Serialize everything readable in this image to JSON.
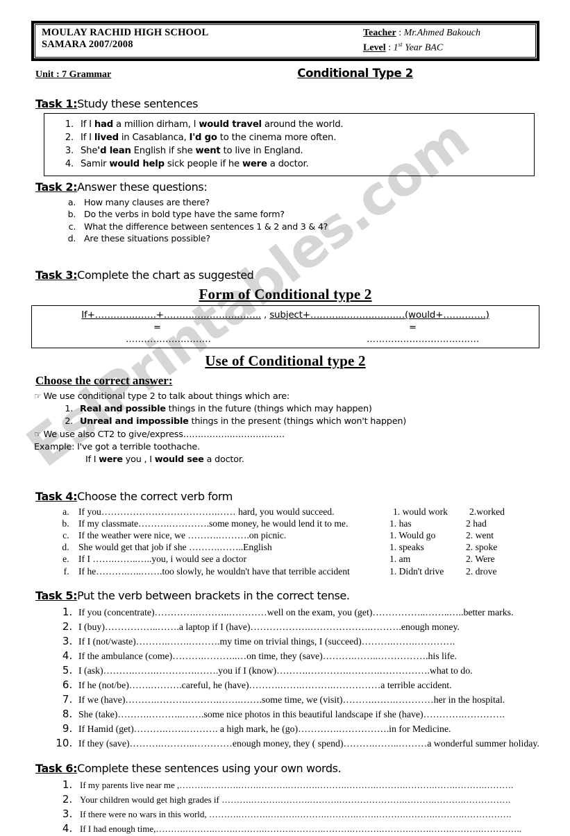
{
  "header": {
    "school_line1": "MOULAY RACHID HIGH SCHOOL",
    "school_line2": "SAMARA 2007/2008",
    "teacher_label": "Teacher",
    "teacher_sep": " : ",
    "teacher_name": "Mr.Ahmed Bakouch",
    "level_label": "Level",
    "level_sep": " : ",
    "level_value_num": "1",
    "level_value_sup": "st",
    "level_value_rest": " Year BAC"
  },
  "unit": {
    "label": "Unit : 7  Grammar",
    "title": "Conditional Type 2"
  },
  "watermark": "EslPrintables.com",
  "task1": {
    "number": "Task 1:",
    "title": "Study these sentences",
    "sentences": [
      {
        "pre": "If I ",
        "b1": "had",
        "mid": " a million dirham, I ",
        "b2": "would  travel",
        "post": " around the world."
      },
      {
        "pre": "If I ",
        "b1": "lived",
        "mid": " in Casablanca, ",
        "b2": "I'd go",
        "post": " to the cinema more often."
      },
      {
        "pre": "She",
        "b1": "'d  lean",
        "mid": " English if she ",
        "b2": "went",
        "post": " to live in England."
      },
      {
        "pre": "Samir ",
        "b1": "would  help",
        "mid": " sick people if he ",
        "b2": "were",
        "post": " a doctor."
      }
    ]
  },
  "task2": {
    "number": "Task 2:",
    "title": "Answer these questions:",
    "questions": [
      "How many clauses are there?",
      "Do the verbs in bold type have the same form?",
      "What the difference between sentences 1 & 2 and 3 & 4?",
      "Are these situations possible?"
    ]
  },
  "task3": {
    "number": "Task 3:",
    "title": "Complete the chart as suggested",
    "form_heading": "Form of Conditional type 2",
    "form": {
      "seg1": "If+………….…….+……….….……….……..",
      "seg_comma": " , ",
      "seg2": "subject+………..……….…….…",
      "seg3": "(would+…………..)",
      "equals_left": "=",
      "equals_right": "=",
      "dots_left": "…………..…….…….",
      "dots_right": "…………..……….…….…..."
    },
    "use_heading": "Use of   Conditional type 2"
  },
  "use_section": {
    "choose_heading": "Choose the correct answer:",
    "hand_icon": "☞",
    "line1": "We use conditional type 2 to talk about things which are:",
    "options": [
      {
        "bold": "Real and possible",
        "rest": " things in the future (things which may happen)"
      },
      {
        "bold": "Unreal and impossible",
        "rest": " things in the present (things which won't happen)"
      }
    ],
    "line2": "We use also CT2 to give/express……………..………………",
    "example_label": "Example: I've got a terrible toothache.",
    "example_line": {
      "pre": "If I ",
      "b1": "were",
      "mid": " you , I ",
      "b2": "would see",
      "post": " a doctor."
    }
  },
  "task4": {
    "number": "Task 4:",
    "title": "Choose the correct verb form",
    "items": [
      "If you……………………………….…… hard, you would succeed.",
      "If my classmate……….………….some money, he would lend it to me.",
      "If the weather were nice, we ……….……….on picnic.",
      "She would get that job if she ……….……..English",
      "If I  …….……..…..you, i would see a doctor",
      "If he……….…..…….too slowly, he wouldn't have that terrible accident"
    ],
    "options": [
      {
        "opt1": "1. would work",
        "opt2": "2.worked"
      },
      {
        "opt1": "1. has",
        "opt2": "2 had"
      },
      {
        "opt1": "1. Would go",
        "opt2": "2. went"
      },
      {
        "opt1": "1. speaks",
        "opt2": "2. spoke"
      },
      {
        "opt1": "1. am",
        "opt2": "2. Were"
      },
      {
        "opt1": "1. Didn't drive",
        "opt2": "2. drove"
      }
    ]
  },
  "task5": {
    "number": "Task 5:",
    "title": "Put the verb between brackets in the correct tense.",
    "items": [
      "If you (concentrate)………….………..…………well on the exam, you (get)……………..……..…..better marks.",
      "I (buy)……………..…….a laptop if I (have)……………….……………….……….enough money.",
      "If I (not/waste)……….…….……….my time on trivial things, I (succeed)……….…….………….",
      "If the ambulance (come)……….………..…on time, they (save)……….……..…………….his life.",
      "I (ask)……….…….………….…….you if I (know)……….………….……….…………….what to do.",
      "If he (not/be)…….……….careful, he (have)……….…….……….……………a terrible accident.",
      "If we (have)……….……….……….…….…….some time, we (visit)……….…….…………her in the hospital.",
      "She (take)……….………..…….some nice photos in this beautiful landscape if she (have)………….………….",
      "If Hamid (get)……….…….………. a high mark, he (go)………….…………….in for Medicine.",
      "If they (save)……….………..…………enough money, they ( spend)……….……..………a wonderful summer holiday."
    ]
  },
  "task6": {
    "number": "Task 6:",
    "title": "Complete these sentences using your own words.",
    "items": [
      "If my parents live near me ,……….……….…….……….……….……….……….……….……….…….……….……….",
      "Your children would get high grades if ……….……….……….……….………………….……….……….…………….",
      "If there were no wars in this world, ……….……….……….……….……….…….……….……….……….…………….",
      "If I had enough time,……….……….…….……….……….……….……….……….……….…….…….……….………….."
    ]
  }
}
